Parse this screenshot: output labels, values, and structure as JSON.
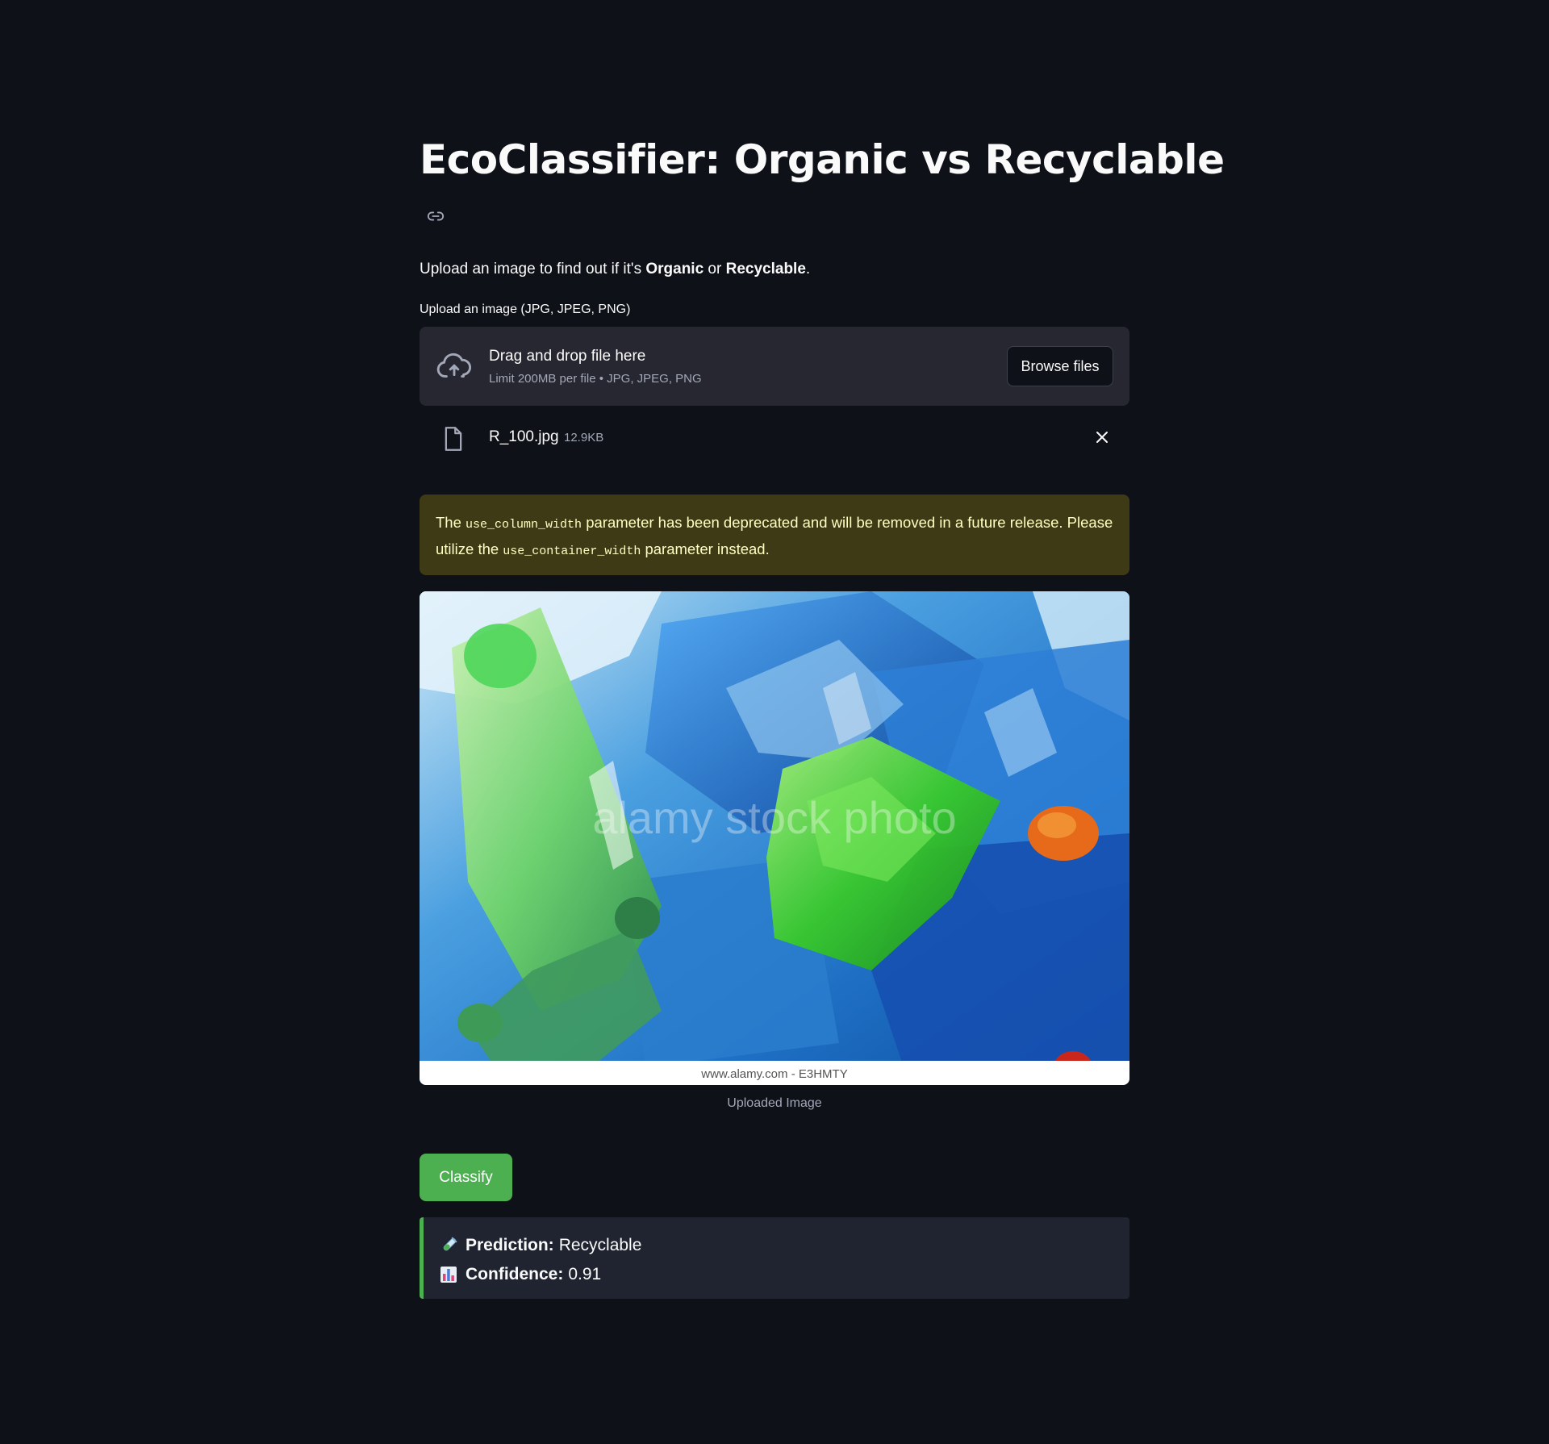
{
  "page": {
    "title": "EcoClassifier: Organic vs Recyclable",
    "intro": {
      "prefix": "Upload an image to find out if it's ",
      "organic": "Organic",
      "or": " or ",
      "recyclable": "Recyclable",
      "suffix": "."
    }
  },
  "uploader": {
    "label": "Upload an image (JPG, JPEG, PNG)",
    "drag_text": "Drag and drop file here",
    "limit_text": "Limit 200MB per file • JPG, JPEG, PNG",
    "browse_label": "Browse files",
    "icon": "cloud-upload-icon"
  },
  "file": {
    "name": "R_100.jpg",
    "size": "12.9KB",
    "icon": "file-icon"
  },
  "warning": {
    "part1": "The ",
    "code1": "use_column_width",
    "part2": " parameter has been deprecated and will be removed in a future release. Please utilize the ",
    "code2": "use_container_width",
    "part3": " parameter instead."
  },
  "image": {
    "watermark": "alamy stock photo",
    "footer_text": "www.alamy.com - E3HMTY",
    "caption": "Uploaded Image"
  },
  "actions": {
    "classify_label": "Classify"
  },
  "result": {
    "prediction_label": "Prediction:",
    "prediction_value": "Recyclable",
    "confidence_label": "Confidence:",
    "confidence_value": "0.91"
  },
  "colors": {
    "background": "#0e1117",
    "accent": "#4caf50",
    "warning_bg": "#3e3a16",
    "warning_text": "#ffffc2"
  }
}
